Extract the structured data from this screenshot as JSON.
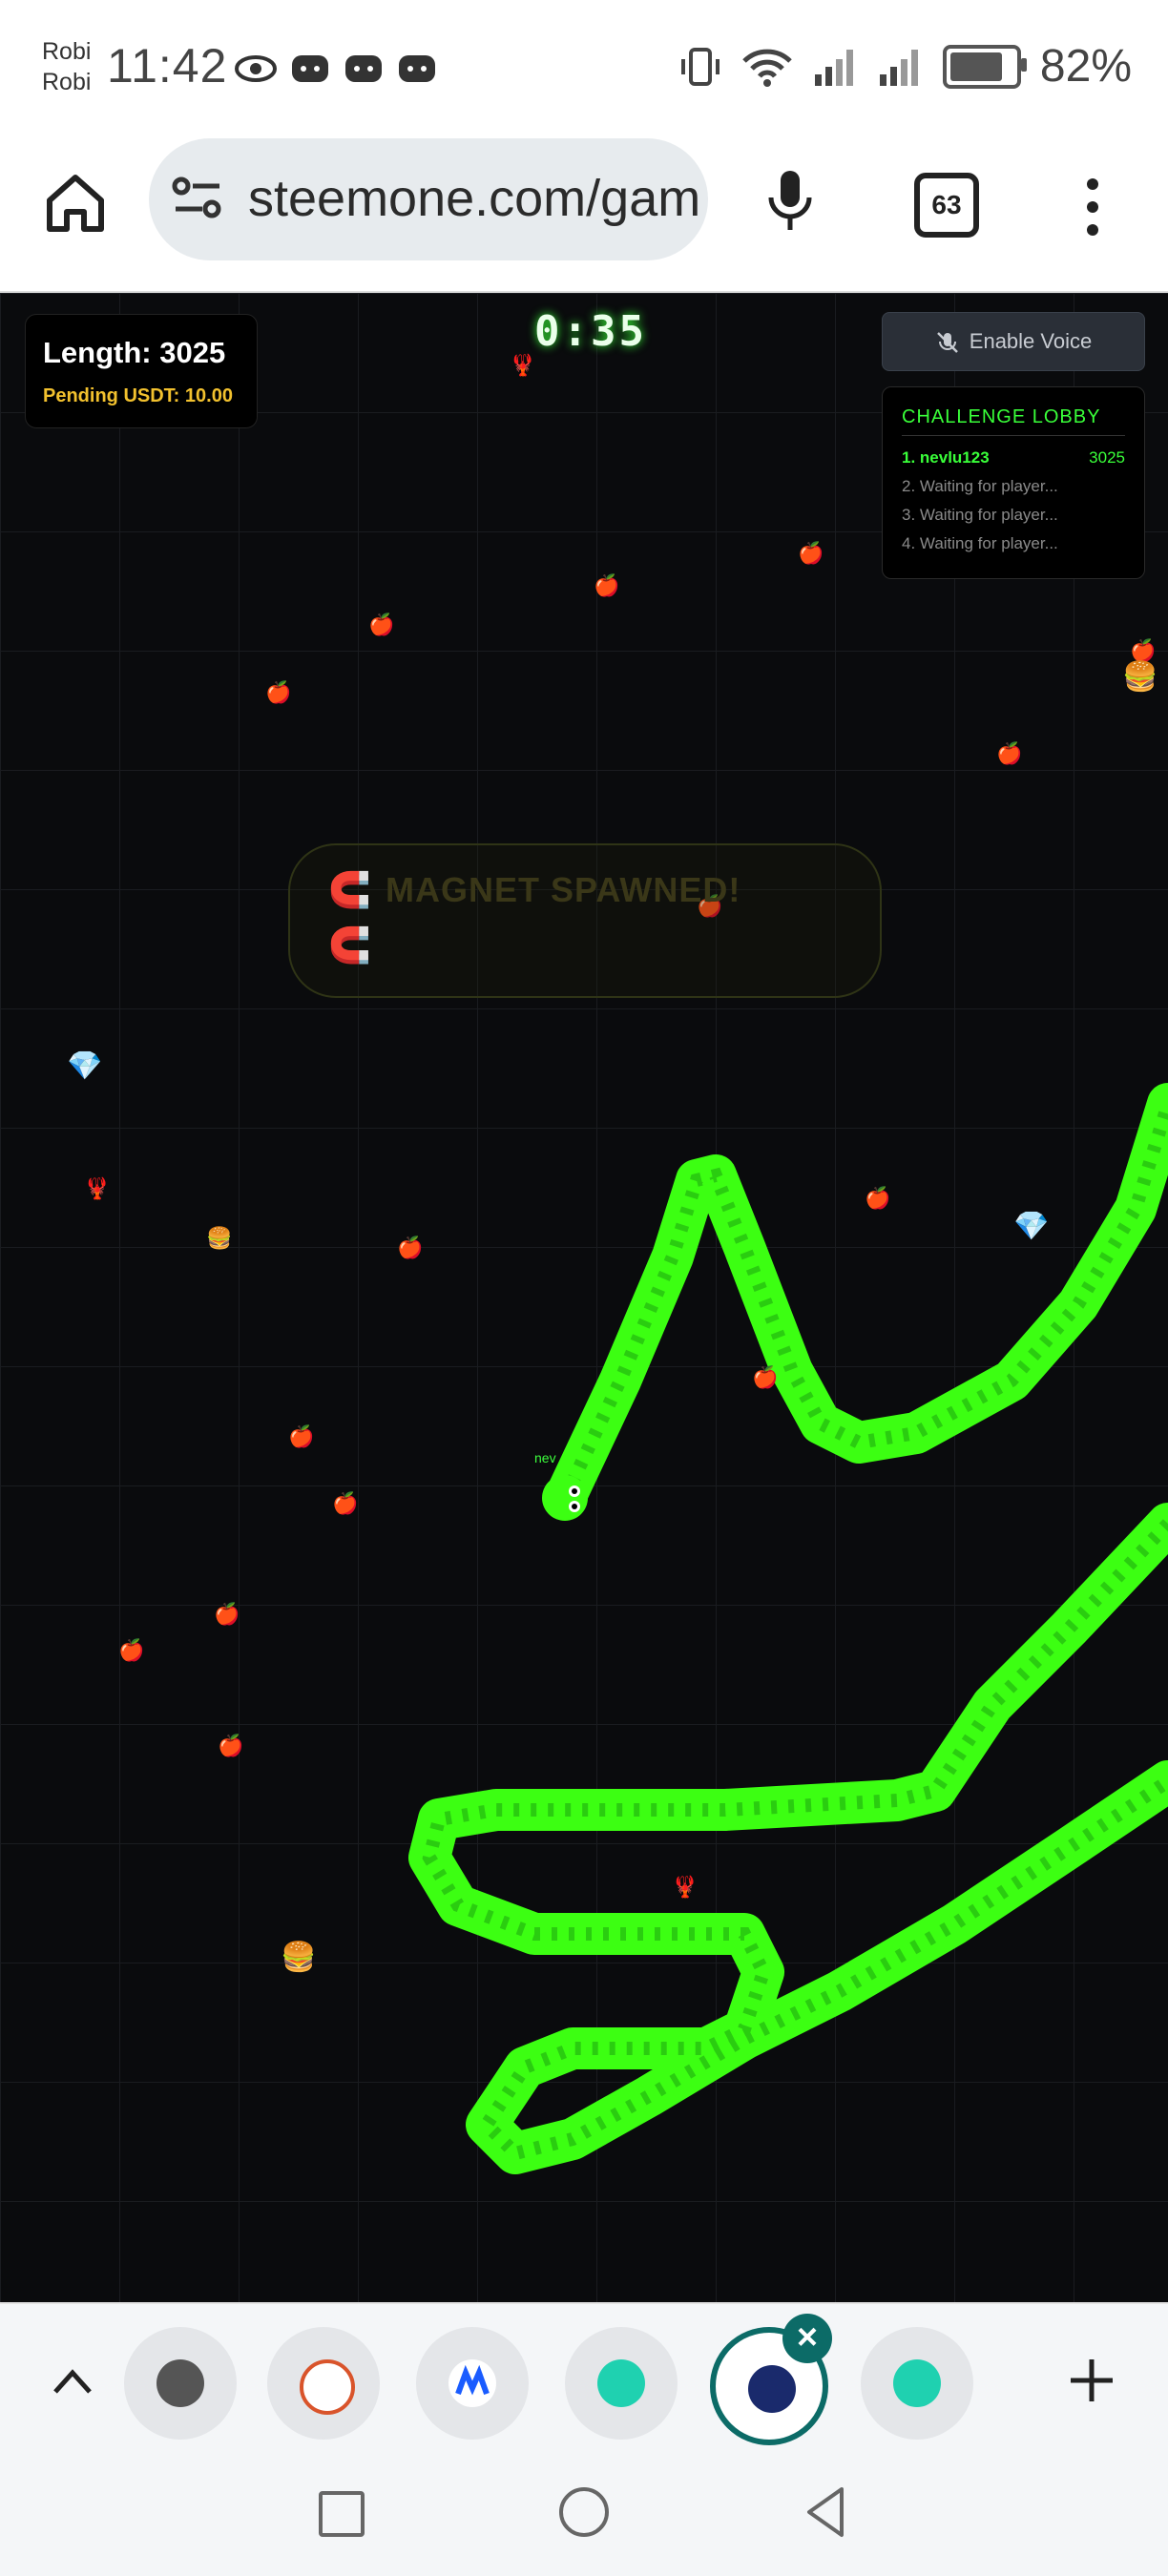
{
  "status_bar": {
    "carrier_line1": "Robi",
    "carrier_line2": "Robi",
    "time": "11:42",
    "battery_percent": "82%",
    "battery_level": 0.82
  },
  "browser": {
    "url": "steemone.com/gam",
    "tab_count": "63"
  },
  "game": {
    "length_label": "Length: 3025",
    "pending_label": "Pending USDT: 10.00",
    "timer": "0:35",
    "voice_button_label": "Enable Voice",
    "lobby": {
      "title": "CHALLENGE LOBBY",
      "rows": [
        {
          "label": "1. nevlu123",
          "score": "3025"
        },
        {
          "label": "2. Waiting for player..."
        },
        {
          "label": "3. Waiting for player..."
        },
        {
          "label": "4. Waiting for player..."
        }
      ]
    },
    "banner_text": "MAGNET SPAWNED!",
    "snake_name": "nev",
    "colors": {
      "snake": "#39ff14",
      "accent": "#39ff39",
      "pending": "#f2c12e"
    }
  },
  "bottom_bar": {
    "tabs": [
      "globe-tab",
      "puzzle-tab",
      "meta-tab",
      "chat-tab",
      "steem-tab",
      "chat-tab-2"
    ],
    "active_tab_index": 4
  }
}
